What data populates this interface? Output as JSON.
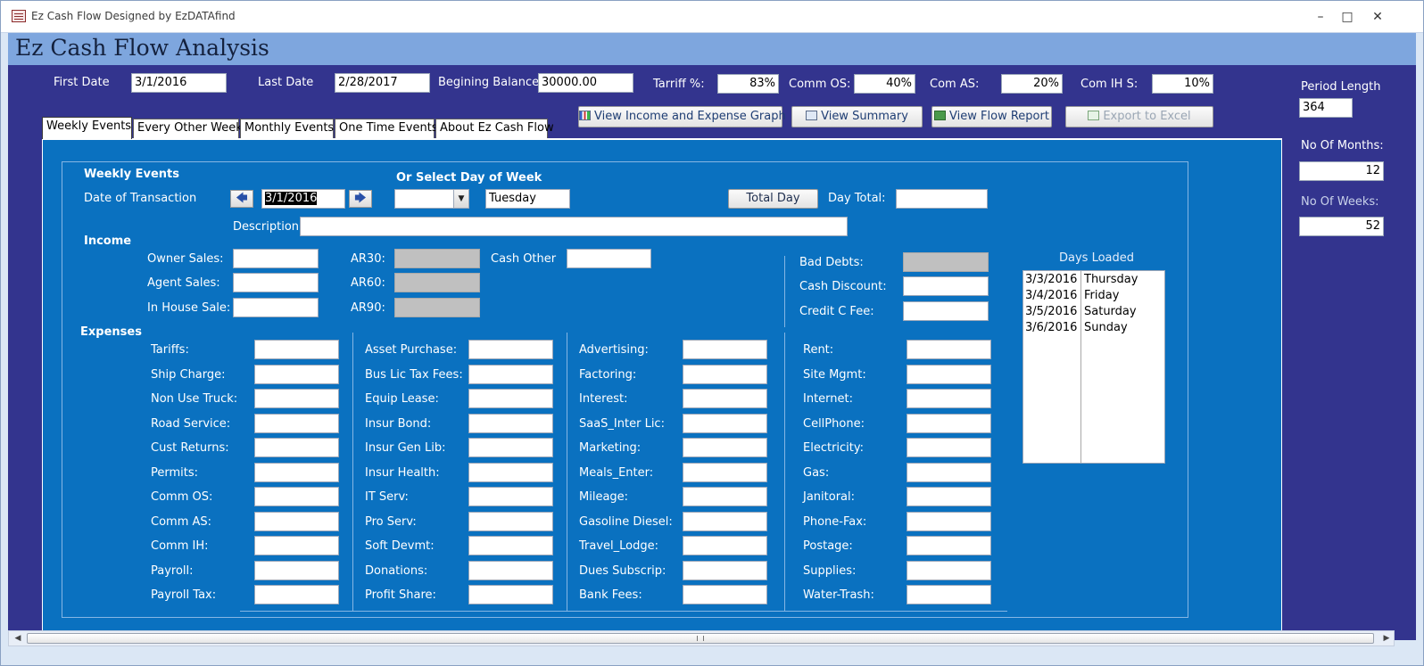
{
  "window": {
    "title": "Ez Cash Flow Designed by EzDATAfind",
    "minimize": "–",
    "maximize": "□",
    "close": "✕"
  },
  "app_title": "Ez Cash Flow Analysis",
  "header": {
    "first_date_label": "First Date",
    "first_date": "3/1/2016",
    "last_date_label": "Last Date",
    "last_date": "2/28/2017",
    "beginning_balance_label": "Begining Balance",
    "beginning_balance": "30000.00",
    "tariff_label": "Tarriff %:",
    "tariff": "83%",
    "comm_os_label": "Comm OS:",
    "comm_os": "40%",
    "com_as_label": "Com AS:",
    "com_as": "20%",
    "com_ihs_label": "Com IH S:",
    "com_ihs": "10%"
  },
  "right_panel": {
    "period_length_label": "Period Length",
    "period_length": "364",
    "months_label": "No Of Months:",
    "months": "12",
    "weeks_label": "No Of Weeks:",
    "weeks": "52"
  },
  "toolbar": {
    "graph": "View Income and Expense Graph",
    "summary": "View Summary",
    "flow_report": "View Flow Report",
    "export": "Export to Excel"
  },
  "tabs": [
    "Weekly Events",
    "Every Other Week",
    "Monthly Events",
    "One Time Events",
    "About Ez Cash Flow"
  ],
  "form": {
    "section_title": "Weekly Events",
    "day_of_week_title": "Or Select Day of Week",
    "date_label": "Date of Transaction",
    "date_value": "3/1/2016",
    "prev_icon": "🡄",
    "next_icon": "🡆",
    "combo_arrow": "▼",
    "weekday": "Tuesday",
    "total_day_button": "Total Day",
    "day_total_label": "Day Total:",
    "description_label": "Description",
    "income_label": "Income",
    "expenses_label": "Expenses",
    "owner_sales": "Owner Sales:",
    "agent_sales": "Agent Sales:",
    "in_house_sale": "In House Sale:",
    "ar30": "AR30:",
    "ar60": "AR60:",
    "ar90": "AR90:",
    "cash_other": "Cash Other",
    "bad_debts": "Bad Debts:",
    "cash_discount": "Cash Discount:",
    "credit_fee": "Credit C Fee:",
    "expenses_col1": [
      "Tariffs:",
      "Ship Charge:",
      "Non Use Truck:",
      "Road Service:",
      "Cust Returns:",
      "Permits:",
      "Comm OS:",
      "Comm AS:",
      "Comm IH:",
      "Payroll:",
      "Payroll Tax:"
    ],
    "expenses_col2": [
      "Asset Purchase:",
      "Bus Lic Tax Fees:",
      "Equip Lease:",
      "Insur Bond:",
      "Insur Gen Lib:",
      "Insur Health:",
      "IT Serv:",
      "Pro Serv:",
      "Soft Devmt:",
      "Donations:",
      "Profit Share:"
    ],
    "expenses_col3": [
      "Advertising:",
      "Factoring:",
      "Interest:",
      "SaaS_Inter Lic:",
      "Marketing:",
      "Meals_Enter:",
      "Mileage:",
      "Gasoline Diesel:",
      "Travel_Lodge:",
      "Dues Subscrip:",
      "Bank Fees:"
    ],
    "expenses_col4": [
      "Rent:",
      "Site Mgmt:",
      "Internet:",
      "CellPhone:",
      "Electricity:",
      "Gas:",
      "Janitoral:",
      "Phone-Fax:",
      "Postage:",
      "Supplies:",
      "Water-Trash:"
    ]
  },
  "days_loaded": {
    "title": "Days Loaded",
    "rows": [
      {
        "date": "3/3/2016",
        "day": "Thursday"
      },
      {
        "date": "3/4/2016",
        "day": "Friday"
      },
      {
        "date": "3/5/2016",
        "day": "Saturday"
      },
      {
        "date": "3/6/2016",
        "day": "Sunday"
      }
    ]
  },
  "scrollbar": {
    "left_arrow": "◀",
    "right_arrow": "▶"
  }
}
